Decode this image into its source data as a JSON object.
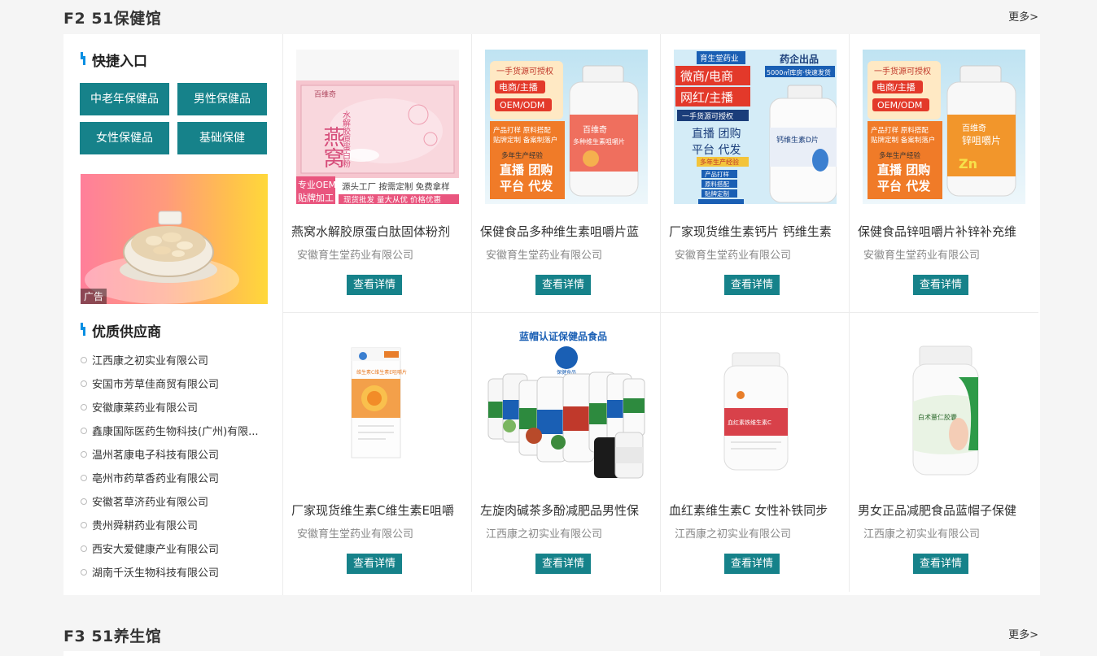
{
  "floor2": {
    "title": "F2 51保健馆",
    "more": "更多>",
    "quick": {
      "title": "快捷入口",
      "buttons": [
        "中老年保健品",
        "男性保健品",
        "女性保健品",
        "基础保健"
      ]
    },
    "ad": {
      "label": "广告"
    },
    "suppliers": {
      "title": "优质供应商",
      "items": [
        "江西康之初实业有限公司",
        "安国市芳草佳商贸有限公司",
        "安徽康莱药业有限公司",
        "鑫康国际医药生物科技(广州)有限...",
        "温州茗康电子科技有限公司",
        "亳州市药草香药业有限公司",
        "安徽茗草济药业有限公司",
        "贵州舜耕药业有限公司",
        "西安大爱健康产业有限公司",
        "湖南千沃生物科技有限公司"
      ]
    },
    "detail_label": "查看详情",
    "products": [
      {
        "name": "燕窝水解胶原蛋白肽固体粉剂",
        "company": "安徽育生堂药业有限公司",
        "img_text": {
          "brand": "百维奇",
          "main": "燕窝",
          "sub": "水解胶原蛋白粉",
          "line1": "专业OEM",
          "line2": "贴牌加工",
          "line3": "源头工厂 按需定制 免费拿样",
          "line4": "现货批发 量大从优 价格优惠"
        }
      },
      {
        "name": "保健食品多种维生素咀嚼片蓝",
        "company": "安徽育生堂药业有限公司",
        "img_text": {
          "t1": "一手货源可授权",
          "t2": "电商/主播",
          "t3": "OEM/ODM",
          "t4": "产品打样 原料搭配",
          "t5": "贴牌定制 备案制落户",
          "t6": "多年生产经验",
          "t7": "直播 团购",
          "t8": "平台 代发",
          "bottle": "百维奇",
          "bottle2": "多种维生素咀嚼片"
        }
      },
      {
        "name": "厂家现货维生素钙片 钙维生素",
        "company": "安徽育生堂药业有限公司",
        "img_text": {
          "t1": "育生堂药业",
          "t2": "药企出品",
          "t3": "5000㎡库房·快速发货",
          "t4": "微商/电商",
          "t5": "网红/主播",
          "t6": "一手货源可授权",
          "t7": "直播 团购",
          "t8": "平台 代发",
          "t9": "多年生产经验",
          "t10": "产品打样",
          "t11": "原料搭配",
          "t12": "贴牌定制",
          "t13": "备案制落户",
          "bottle": "钙维生素D片"
        }
      },
      {
        "name": "保健食品锌咀嚼片补锌补充维",
        "company": "安徽育生堂药业有限公司",
        "img_text": {
          "t1": "一手货源可授权",
          "t2": "电商/主播",
          "t3": "OEM/ODM",
          "t4": "产品打样 原料搭配",
          "t5": "贴牌定制 备案制落户",
          "t6": "多年生产经验",
          "t7": "直播 团购",
          "t8": "平台 代发",
          "bottle": "百维奇",
          "bottle2": "锌咀嚼片",
          "zn": "Zn"
        }
      },
      {
        "name": "厂家现货维生素C维生素E咀嚼",
        "company": "安徽育生堂药业有限公司",
        "img_text": {
          "box": "维生素C维生素E咀嚼片"
        }
      },
      {
        "name": "左旋肉碱茶多酚减肥品男性保",
        "company": "江西康之初实业有限公司",
        "img_text": {
          "banner": "蓝帽认证保健品食品",
          "logo": "保健食品"
        }
      },
      {
        "name": "血红素维生素C 女性补铁同步",
        "company": "江西康之初实业有限公司",
        "img_text": {
          "label": "血红素铁维生素C"
        }
      },
      {
        "name": "男女正品减肥食品蓝帽子保健",
        "company": "江西康之初实业有限公司",
        "img_text": {
          "label": "白术薏仁胶囊"
        }
      }
    ]
  },
  "floor3": {
    "title": "F3 51养生馆",
    "more": "更多>"
  },
  "colors": {
    "accent": "#16828a",
    "title_bar": "#0a8fe2",
    "page_bg": "#f5f5f5"
  }
}
